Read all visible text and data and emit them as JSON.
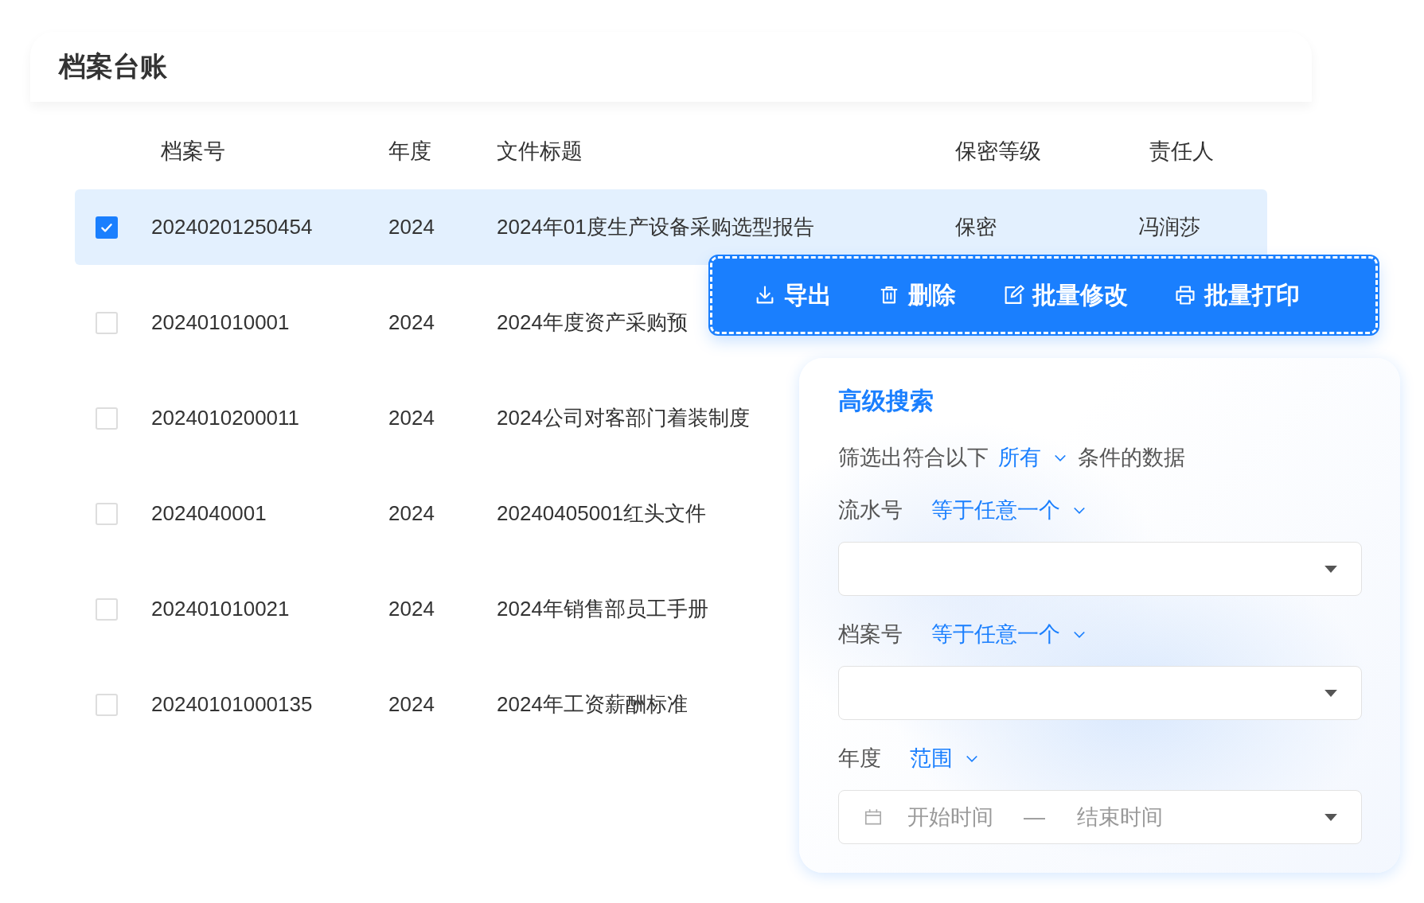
{
  "page_title": "档案台账",
  "table": {
    "columns": [
      "档案号",
      "年度",
      "文件标题",
      "保密等级",
      "责任人"
    ],
    "rows": [
      {
        "selected": true,
        "cells": [
          "20240201250454",
          "2024",
          "2024年01度生产设备采购选型报告",
          "保密",
          "冯润莎"
        ]
      },
      {
        "selected": false,
        "cells": [
          "202401010001",
          "2024",
          "2024年度资产采购预"
        ]
      },
      {
        "selected": false,
        "cells": [
          "2024010200011",
          "2024",
          "2024公司对客部门着装制度"
        ]
      },
      {
        "selected": false,
        "cells": [
          "2024040001",
          "2024",
          "20240405001红头文件"
        ]
      },
      {
        "selected": false,
        "cells": [
          "202401010021",
          "2024",
          "2024年销售部员工手册"
        ]
      },
      {
        "selected": false,
        "cells": [
          "20240101000135",
          "2024",
          "2024年工资薪酬标准"
        ]
      }
    ]
  },
  "toolbar": {
    "buttons": [
      {
        "kind": "export",
        "label": "导出"
      },
      {
        "kind": "delete",
        "label": "删除"
      },
      {
        "kind": "edit",
        "label": "批量修改"
      },
      {
        "kind": "print",
        "label": "批量打印"
      }
    ]
  },
  "advanced_search": {
    "title": "高级搜索",
    "match_prefix": "筛选出符合以下",
    "match_mode": "所有",
    "match_suffix": "条件的数据",
    "conditions": [
      {
        "kind": "select",
        "field": "流水号",
        "operator": "等于任意一个"
      },
      {
        "kind": "select",
        "field": "档案号",
        "operator": "等于任意一个"
      },
      {
        "kind": "date_range",
        "field": "年度",
        "operator": "范围",
        "start_placeholder": "开始时间",
        "separator": "—",
        "end_placeholder": "结束时间"
      }
    ]
  }
}
